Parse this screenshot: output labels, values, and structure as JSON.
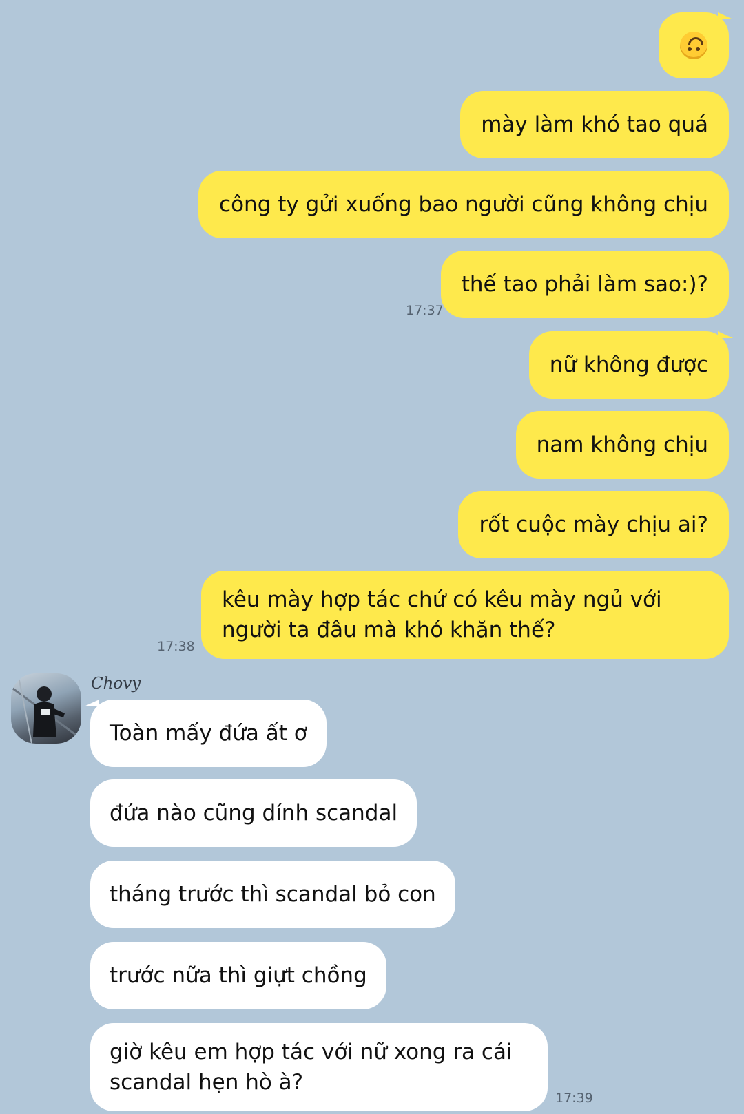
{
  "chat": {
    "outgoing": [
      {
        "emoji": "upside-down-face-emoji"
      },
      {
        "text": "mày làm khó tao quá"
      },
      {
        "text": "công ty gửi xuống bao người cũng không chịu"
      },
      {
        "text": "thế tao phải làm sao:)?"
      },
      {
        "text": "nữ không được"
      },
      {
        "text": "nam không chịu"
      },
      {
        "text": "rốt cuộc mày chịu ai?"
      },
      {
        "text": "kêu mày hợp tác chứ có kêu mày ngủ với người ta đâu mà khó khăn thế?"
      }
    ],
    "outgoing_times": [
      "17:37",
      "17:38"
    ],
    "contact": {
      "name": "Chovy",
      "avatar_icon": "user-avatar-photo"
    },
    "incoming": [
      {
        "text": "Toàn mấy đứa ất ơ"
      },
      {
        "text": "đứa nào cũng dính scandal"
      },
      {
        "text": "tháng trước thì scandal bỏ con"
      },
      {
        "text": "trước nữa thì giựt chồng"
      },
      {
        "text": "giờ kêu em hợp tác với nữ xong ra cái scandal hẹn hò à?"
      }
    ],
    "incoming_time": "17:39"
  },
  "colors": {
    "background": "#b2c7d9",
    "outgoing_bubble": "#fee94c",
    "incoming_bubble": "#ffffff"
  }
}
